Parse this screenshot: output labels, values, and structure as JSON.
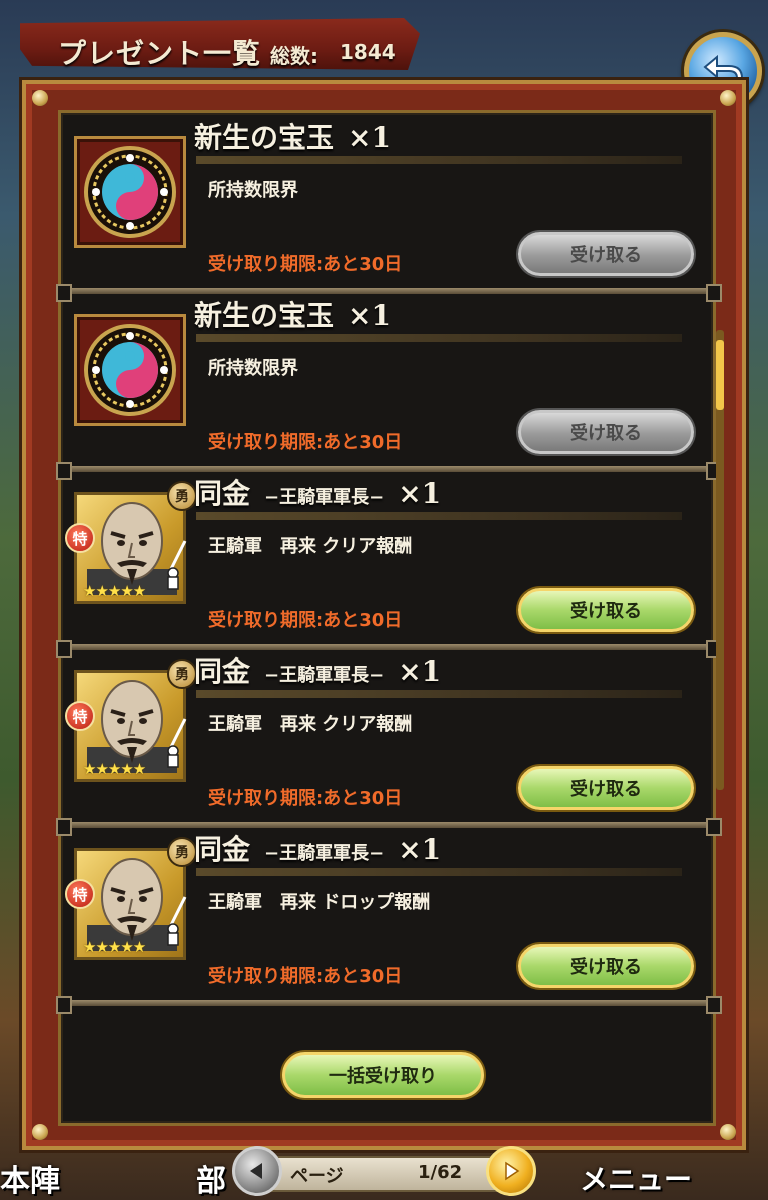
{
  "header": {
    "title": "プレゼント一覧",
    "count_label": "総数:",
    "count_value": "1844"
  },
  "items": [
    {
      "name": "新生の宝玉",
      "subtitle": "",
      "quantity": "×1",
      "description": "所持数限界",
      "deadline": "受け取り期限:あと30日",
      "button": "受け取る",
      "button_state": "disabled",
      "icon": "gem-icon"
    },
    {
      "name": "新生の宝玉",
      "subtitle": "",
      "quantity": "×1",
      "description": "所持数限界",
      "deadline": "受け取り期限:あと30日",
      "button": "受け取る",
      "button_state": "disabled",
      "icon": "gem-icon"
    },
    {
      "name": "同金",
      "subtitle": "−王騎軍軍長−",
      "quantity": "×1",
      "description": "王騎軍　再来 クリア報酬",
      "deadline": "受け取り期限:あと30日",
      "button": "受け取る",
      "button_state": "enabled",
      "icon": "general-portrait",
      "badge_top": "勇",
      "badge_left": "特",
      "stars": "★★★★★"
    },
    {
      "name": "同金",
      "subtitle": "−王騎軍軍長−",
      "quantity": "×1",
      "description": "王騎軍　再来 クリア報酬",
      "deadline": "受け取り期限:あと30日",
      "button": "受け取る",
      "button_state": "enabled",
      "icon": "general-portrait",
      "badge_top": "勇",
      "badge_left": "特",
      "stars": "★★★★★"
    },
    {
      "name": "同金",
      "subtitle": "−王騎軍軍長−",
      "quantity": "×1",
      "description": "王騎軍　再来 ドロップ報酬",
      "deadline": "受け取り期限:あと30日",
      "button": "受け取る",
      "button_state": "enabled",
      "icon": "general-portrait",
      "badge_top": "勇",
      "badge_left": "特",
      "stars": "★★★★★"
    }
  ],
  "bulk_button": "一括受け取り",
  "pager": {
    "label": "ページ",
    "current": "1/62"
  },
  "bottom_nav": {
    "left": "本陣",
    "mid": "部",
    "right": "メニュー"
  },
  "colors": {
    "deadline": "#f06b2a",
    "panel": "#7b2a18",
    "enabled_button": "#a9d86a"
  }
}
